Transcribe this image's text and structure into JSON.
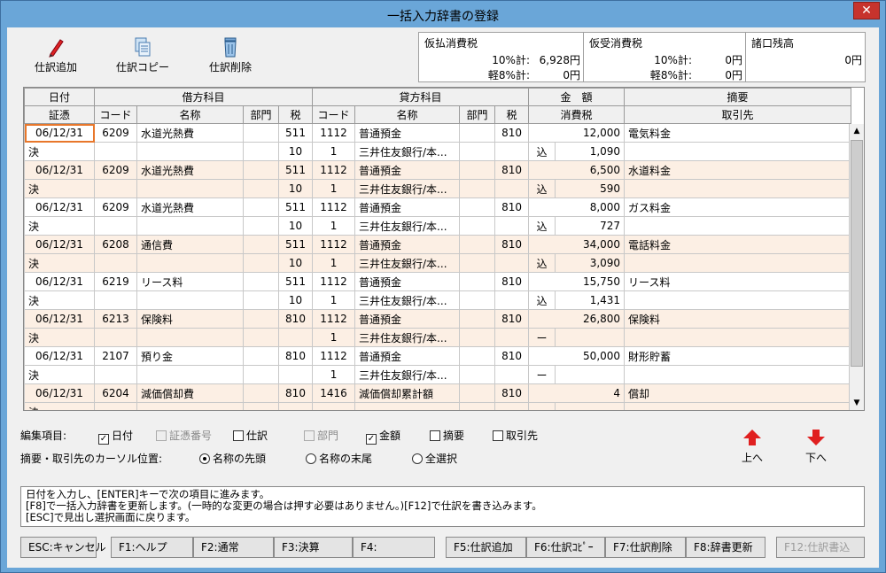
{
  "window": {
    "title": "一括入力辞書の登録",
    "close": "✕"
  },
  "toolbar": [
    {
      "name": "journal-add-button",
      "label": "仕訳追加",
      "icon": "pen-icon"
    },
    {
      "name": "journal-copy-button",
      "label": "仕訳コピー",
      "icon": "copy-icon"
    },
    {
      "name": "journal-delete-button",
      "label": "仕訳削除",
      "icon": "trash-icon"
    }
  ],
  "tax": {
    "paid": {
      "title": "仮払消費税",
      "r10_label": "10%計:",
      "r10_value": "6,928円",
      "r8_label": "軽8%計:",
      "r8_value": "0円"
    },
    "received": {
      "title": "仮受消費税",
      "r10_label": "10%計:",
      "r10_value": "0円",
      "r8_label": "軽8%計:",
      "r8_value": "0円"
    },
    "balance": {
      "title": "諸口残高",
      "value": "0円"
    }
  },
  "grid": {
    "header1": [
      "日付",
      "借方科目",
      "貸方科目",
      "金　額",
      "摘要"
    ],
    "header2": [
      "証憑",
      "コード",
      "名称",
      "部門",
      "税",
      "コード",
      "名称",
      "部門",
      "税",
      "消費税",
      "取引先"
    ],
    "entries": [
      {
        "date": "06/12/31",
        "d_code": "6209",
        "d_name": "水道光熱費",
        "d_tax": "511",
        "c_code": "1112",
        "c_name": "普通預金",
        "c_tax": "810",
        "amount": "12,000",
        "memo": "電気料金",
        "kind": "決",
        "d_tax2": "10",
        "c_tax2": "1",
        "c_name2": "三井住友銀行/本...",
        "tax_mark": "込",
        "tax_amount": "1,090"
      },
      {
        "date": "06/12/31",
        "d_code": "6209",
        "d_name": "水道光熱費",
        "d_tax": "511",
        "c_code": "1112",
        "c_name": "普通預金",
        "c_tax": "810",
        "amount": "6,500",
        "memo": "水道料金",
        "kind": "決",
        "d_tax2": "10",
        "c_tax2": "1",
        "c_name2": "三井住友銀行/本...",
        "tax_mark": "込",
        "tax_amount": "590"
      },
      {
        "date": "06/12/31",
        "d_code": "6209",
        "d_name": "水道光熱費",
        "d_tax": "511",
        "c_code": "1112",
        "c_name": "普通預金",
        "c_tax": "810",
        "amount": "8,000",
        "memo": "ガス料金",
        "kind": "決",
        "d_tax2": "10",
        "c_tax2": "1",
        "c_name2": "三井住友銀行/本...",
        "tax_mark": "込",
        "tax_amount": "727"
      },
      {
        "date": "06/12/31",
        "d_code": "6208",
        "d_name": "通信費",
        "d_tax": "511",
        "c_code": "1112",
        "c_name": "普通預金",
        "c_tax": "810",
        "amount": "34,000",
        "memo": "電話料金",
        "kind": "決",
        "d_tax2": "10",
        "c_tax2": "1",
        "c_name2": "三井住友銀行/本...",
        "tax_mark": "込",
        "tax_amount": "3,090"
      },
      {
        "date": "06/12/31",
        "d_code": "6219",
        "d_name": "リース料",
        "d_tax": "511",
        "c_code": "1112",
        "c_name": "普通預金",
        "c_tax": "810",
        "amount": "15,750",
        "memo": "リース料",
        "kind": "決",
        "d_tax2": "10",
        "c_tax2": "1",
        "c_name2": "三井住友銀行/本...",
        "tax_mark": "込",
        "tax_amount": "1,431"
      },
      {
        "date": "06/12/31",
        "d_code": "6213",
        "d_name": "保険料",
        "d_tax": "810",
        "c_code": "1112",
        "c_name": "普通預金",
        "c_tax": "810",
        "amount": "26,800",
        "memo": "保険料",
        "kind": "決",
        "d_tax2": "",
        "c_tax2": "1",
        "c_name2": "三井住友銀行/本...",
        "tax_mark": "ー",
        "tax_amount": ""
      },
      {
        "date": "06/12/31",
        "d_code": "2107",
        "d_name": "預り金",
        "d_tax": "810",
        "c_code": "1112",
        "c_name": "普通預金",
        "c_tax": "810",
        "amount": "50,000",
        "memo": "財形貯蓄",
        "kind": "決",
        "d_tax2": "",
        "c_tax2": "1",
        "c_name2": "三井住友銀行/本...",
        "tax_mark": "ー",
        "tax_amount": ""
      },
      {
        "date": "06/12/31",
        "d_code": "6204",
        "d_name": "減価償却費",
        "d_tax": "810",
        "c_code": "1416",
        "c_name": "減価償却累計額",
        "c_tax": "810",
        "amount": "4",
        "memo": "償却",
        "kind": "決",
        "d_tax2": "",
        "c_tax2": "",
        "c_name2": "",
        "tax_mark": "ー",
        "tax_amount": ""
      }
    ]
  },
  "edit_items": {
    "label": "編集項目:",
    "items": [
      {
        "label": "日付",
        "checked": true,
        "disabled": false
      },
      {
        "label": "証憑番号",
        "checked": false,
        "disabled": true
      },
      {
        "label": "仕訳",
        "checked": false,
        "disabled": false
      },
      {
        "label": "部門",
        "checked": false,
        "disabled": true
      },
      {
        "label": "金額",
        "checked": true,
        "disabled": false
      },
      {
        "label": "摘要",
        "checked": false,
        "disabled": false
      },
      {
        "label": "取引先",
        "checked": false,
        "disabled": false
      }
    ]
  },
  "cursor": {
    "label": "摘要・取引先のカーソル位置:",
    "options": [
      {
        "label": "名称の先頭",
        "selected": true
      },
      {
        "label": "名称の末尾",
        "selected": false
      },
      {
        "label": "全選択",
        "selected": false
      }
    ]
  },
  "move": {
    "up": "上へ",
    "down": "下へ"
  },
  "message": [
    "日付を入力し、[ENTER]キーで次の項目に進みます。",
    "[F8]で一括入力辞書を更新します。(一時的な変更の場合は押す必要はありません。)[F12]で仕訳を書き込みます。",
    "[ESC]で見出し選択画面に戻ります。"
  ],
  "fkeys": [
    "ESC:キャンセル",
    "F1:ヘルプ",
    "F2:通常",
    "F3:決算",
    "F4:",
    "F5:仕訳追加",
    "F6:仕訳ｺﾋﾟｰ",
    "F7:仕訳削除",
    "F8:辞書更新",
    "F12:仕訳書込"
  ],
  "colors": {
    "accent": "#e8772b",
    "arrow": "#e02020",
    "window_border": "#6aa6d8",
    "alt_row": "#fcefe4"
  }
}
